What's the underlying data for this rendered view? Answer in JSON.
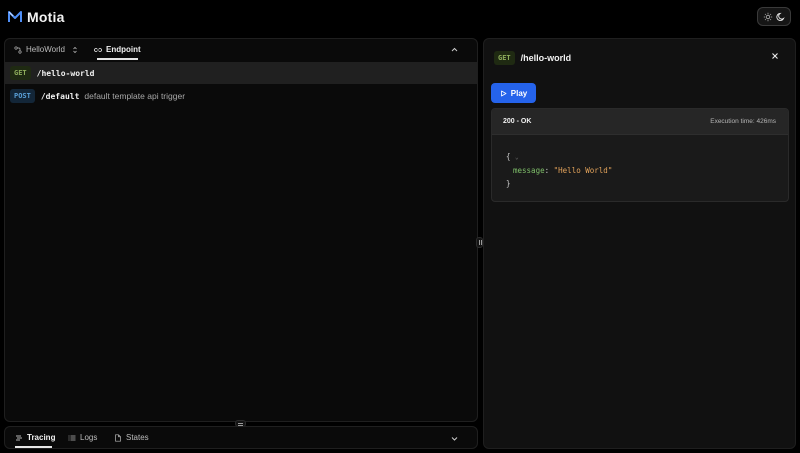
{
  "app": {
    "title": "Motia"
  },
  "theme_toggle": {
    "icons": [
      "sun-icon",
      "moon-icon"
    ]
  },
  "left_tabs": [
    {
      "label": "HelloWorld",
      "icon": "flow-icon",
      "has_selector": true
    },
    {
      "label": "Endpoint",
      "icon": "link-icon",
      "active": true
    }
  ],
  "endpoints": [
    {
      "method": "GET",
      "path": "/hello-world",
      "description": "",
      "selected": true
    },
    {
      "method": "POST",
      "path": "/default",
      "description": "default template api trigger",
      "selected": false
    }
  ],
  "bottom_tabs": [
    {
      "label": "Tracing",
      "icon": "tracing-icon",
      "active": true
    },
    {
      "label": "Logs",
      "icon": "list-icon"
    },
    {
      "label": "States",
      "icon": "file-icon"
    }
  ],
  "detail": {
    "method": "GET",
    "path": "/hello-world",
    "play_label": "Play",
    "response": {
      "status": "200 - OK",
      "execution_time": "Execution time: 426ms",
      "open_brace": "{",
      "key": "message",
      "value": "\"Hello World\"",
      "close_brace": "}"
    }
  },
  "colors": {
    "accent": "#2563eb",
    "get": "#8fae5c",
    "post": "#5aa0d8",
    "json_key": "#7fbf6a",
    "json_string": "#e3a35b"
  }
}
